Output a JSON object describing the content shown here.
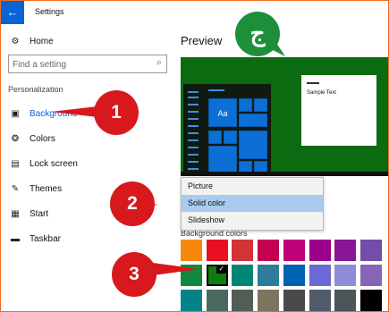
{
  "window": {
    "title": "Settings",
    "back_icon": "back-arrow-icon"
  },
  "sidebar": {
    "home": {
      "label": "Home",
      "icon": "gear-icon"
    },
    "search": {
      "placeholder": "Find a setting",
      "icon": "search-icon"
    },
    "section_title": "Personalization",
    "items": [
      {
        "label": "Background",
        "icon": "picture-icon",
        "selected": true
      },
      {
        "label": "Colors",
        "icon": "palette-icon"
      },
      {
        "label": "Lock screen",
        "icon": "lock-screen-icon"
      },
      {
        "label": "Themes",
        "icon": "brush-icon"
      },
      {
        "label": "Start",
        "icon": "start-menu-icon"
      },
      {
        "label": "Taskbar",
        "icon": "taskbar-icon"
      }
    ]
  },
  "main": {
    "preview_title": "Preview",
    "preview_sample_text": "Sample Text",
    "preview_tile_label": "Aa",
    "dropdown": {
      "options": [
        "Picture",
        "Solid color",
        "Slideshow"
      ],
      "selected": "Solid color"
    },
    "background_colors_label": "Background colors",
    "swatch_colors": [
      [
        "#f7880f",
        "#e81123",
        "#d13438",
        "#c30052",
        "#bf0077",
        "#9a0089",
        "#881798",
        "#744da9"
      ],
      [
        "#10893e",
        "#107c10",
        "#018574",
        "#2d7d9a",
        "#0063b1",
        "#6b69d6",
        "#8e8cd8",
        "#8764b8"
      ],
      [
        "#038387",
        "#486860",
        "#525e54",
        "#7e735f",
        "#4c4a48",
        "#515c6b",
        "#4a5459",
        "#000000"
      ]
    ],
    "selected_swatch": "#107c10"
  },
  "annotations": {
    "callouts": [
      "1",
      "2",
      "3"
    ],
    "logo": "ج"
  },
  "colors": {
    "accent": "#0a64d6",
    "callout": "#d7191e",
    "border": "#f26a22",
    "preview_green": "#0a6b11"
  }
}
